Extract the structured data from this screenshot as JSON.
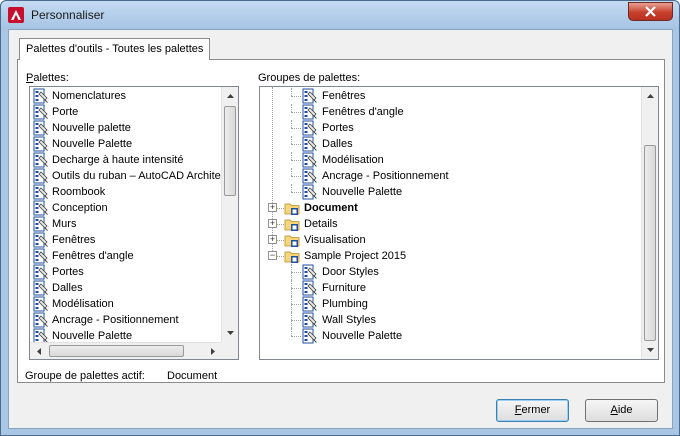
{
  "window": {
    "title": "Personnaliser"
  },
  "tab": {
    "label": "Palettes d'outils - Toutes les palettes"
  },
  "palettes": {
    "label": "Palettes:",
    "items": [
      "Nomenclatures",
      "Porte",
      "Nouvelle palette",
      "Nouvelle Palette",
      "Decharge à haute intensité",
      "Outils du ruban – AutoCAD Architectu",
      "Roombook",
      "Conception",
      "Murs",
      "Fenêtres",
      "Fenêtres d'angle",
      "Portes",
      "Dalles",
      "Modélisation",
      "Ancrage - Positionnement",
      "Nouvelle Palette"
    ]
  },
  "groups": {
    "label": "Groupes de palettes:",
    "tree": [
      {
        "type": "palette",
        "label": "Fenêtres"
      },
      {
        "type": "palette",
        "label": "Fenêtres d'angle"
      },
      {
        "type": "palette",
        "label": "Portes"
      },
      {
        "type": "palette",
        "label": "Dalles"
      },
      {
        "type": "palette",
        "label": "Modélisation"
      },
      {
        "type": "palette",
        "label": "Ancrage - Positionnement"
      },
      {
        "type": "palette",
        "label": "Nouvelle Palette"
      },
      {
        "type": "group",
        "label": "Document",
        "expander": "+",
        "bold": true
      },
      {
        "type": "group",
        "label": "Details",
        "expander": "+"
      },
      {
        "type": "group",
        "label": "Visualisation",
        "expander": "+"
      },
      {
        "type": "group",
        "label": "Sample Project 2015",
        "expander": "−"
      },
      {
        "type": "palette",
        "label": "Door Styles"
      },
      {
        "type": "palette",
        "label": "Furniture"
      },
      {
        "type": "palette",
        "label": "Plumbing"
      },
      {
        "type": "palette",
        "label": "Wall Styles"
      },
      {
        "type": "palette",
        "label": "Nouvelle Palette"
      }
    ]
  },
  "active_group": {
    "label": "Groupe de palettes actif:",
    "value": "Document"
  },
  "buttons": {
    "close_first": "F",
    "close_rest": "ermer",
    "help_first": "A",
    "help_rest": "ide"
  },
  "icons": {
    "palette": "palette-icon",
    "group": "folder-group-icon"
  }
}
